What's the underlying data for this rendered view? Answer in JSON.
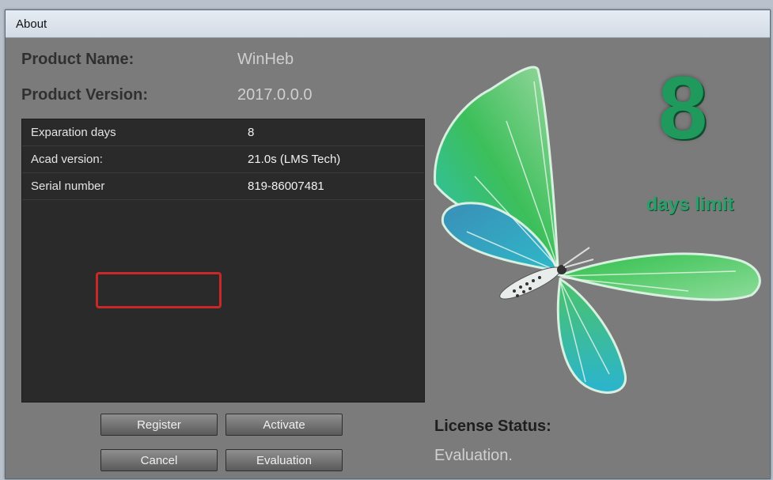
{
  "window": {
    "title": "About"
  },
  "product": {
    "name_label": "Product Name:",
    "name_value": "WinHeb",
    "version_label": "Product Version:",
    "version_value": "2017.0.0.0"
  },
  "details": [
    {
      "key": "Exparation days",
      "value": "8"
    },
    {
      "key": "Acad version:",
      "value": "21.0s (LMS Tech)"
    },
    {
      "key": "Serial number",
      "value": "819-86007481"
    }
  ],
  "buttons": {
    "register": "Register",
    "activate": "Activate",
    "cancel": "Cancel",
    "evaluation": "Evaluation"
  },
  "badge": {
    "days": "8",
    "caption": "days limit"
  },
  "license": {
    "label": "License Status:",
    "value": "Evaluation."
  },
  "colors": {
    "accent": "#1f9a5c",
    "highlight": "#c82828",
    "panel": "#2a2a2a"
  },
  "icons": {
    "illustration": "butterfly-icon"
  }
}
